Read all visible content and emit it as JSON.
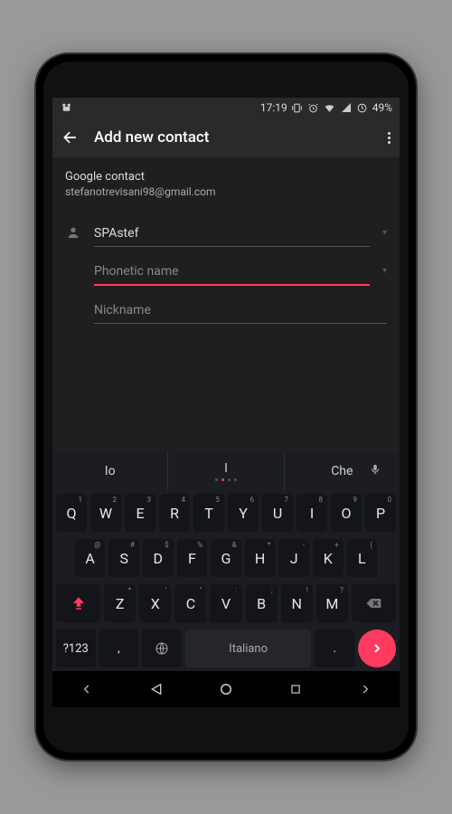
{
  "status": {
    "time": "17:19",
    "battery": "49%"
  },
  "appbar": {
    "title": "Add new contact"
  },
  "account": {
    "type": "Google contact",
    "email": "stefanotrevisani98@gmail.com"
  },
  "fields": {
    "name": {
      "value": "SPAstef"
    },
    "phonetic": {
      "placeholder": "Phonetic name"
    },
    "nickname": {
      "placeholder": "Nickname"
    }
  },
  "suggestions": {
    "left": "Io",
    "mid": "I",
    "right": "Che"
  },
  "keyboard": {
    "r1": [
      "Q",
      "W",
      "E",
      "R",
      "T",
      "Y",
      "U",
      "I",
      "O",
      "P"
    ],
    "r1s": [
      "1",
      "2",
      "3",
      "4",
      "5",
      "6",
      "7",
      "8",
      "9",
      "0"
    ],
    "r2": [
      "A",
      "S",
      "D",
      "F",
      "G",
      "H",
      "J",
      "K",
      "L"
    ],
    "r2s": [
      "@",
      "#",
      "$",
      "%",
      "&",
      "*",
      "-",
      "+",
      "("
    ],
    "r3": [
      "Z",
      "X",
      "C",
      "V",
      "B",
      "N",
      "M"
    ],
    "r3s": [
      "*",
      "'",
      "\"",
      ":",
      ";",
      "!",
      "?"
    ],
    "sym": "?123",
    "comma": ",",
    "space": "Italiano",
    "period": "."
  }
}
